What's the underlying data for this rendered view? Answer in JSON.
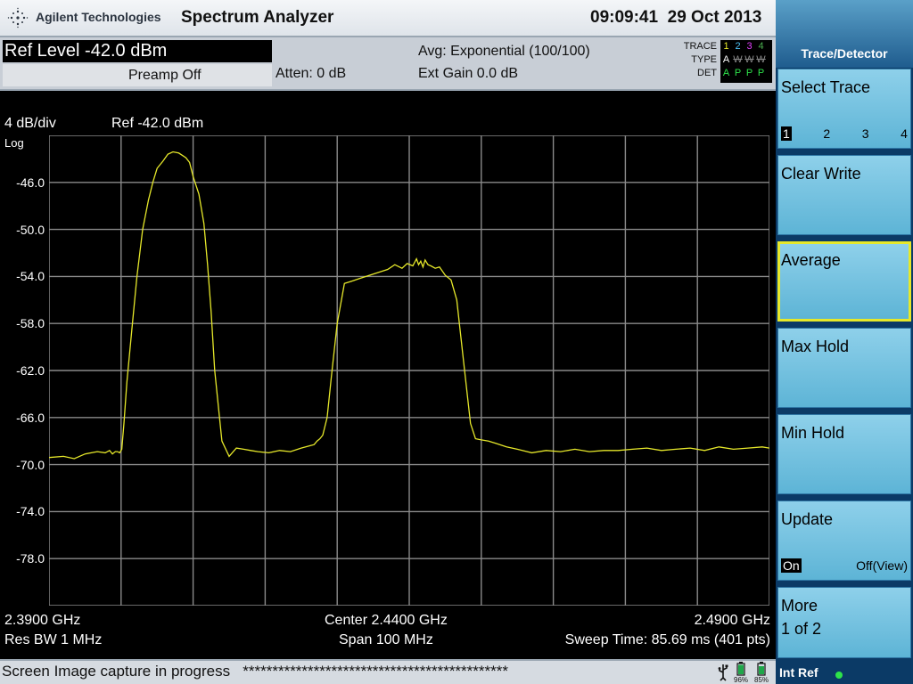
{
  "header": {
    "brand": "Agilent Technologies",
    "app_title": "Spectrum Analyzer",
    "time": "09:09:41",
    "date": "29 Oct 2013"
  },
  "settings": {
    "ref_level": "Ref Level -42.0 dBm",
    "preamp": "Preamp Off",
    "atten": "Atten: 0 dB",
    "avg": "Avg: Exponential (100/100)",
    "ext_gain": "Ext Gain 0.0 dB",
    "trace_labels": {
      "trace": "TRACE",
      "type": "TYPE",
      "det": "DET"
    },
    "trace_numbers": [
      "1",
      "2",
      "3",
      "4"
    ],
    "trace_types": [
      "A",
      "W",
      "W",
      "W"
    ],
    "trace_dets": [
      "A",
      "P",
      "P",
      "P"
    ],
    "trace_colors": [
      "#e6e82a",
      "#4fc3f7",
      "#e040fb",
      "#4caf50"
    ]
  },
  "graph": {
    "scale": "4 dB/div",
    "ref": "Ref -42.0 dBm",
    "log_label": "Log",
    "start_freq": "2.3900 GHz",
    "center_freq": "Center 2.4400 GHz",
    "stop_freq": "2.4900 GHz",
    "res_bw": "Res BW 1 MHz",
    "span": "Span 100 MHz",
    "sweep": "Sweep Time: 85.69 ms (401 pts)",
    "trace_color": "#e6e82a"
  },
  "chart_data": {
    "type": "line",
    "xlabel": "",
    "ylabel": "",
    "xlim": [
      2.39,
      2.49
    ],
    "ylim": [
      -82,
      -42
    ],
    "y_ticks": [
      -46.0,
      -50.0,
      -54.0,
      -58.0,
      -62.0,
      -66.0,
      -70.0,
      -74.0,
      -78.0
    ],
    "y_tick_labels": [
      "-46.0",
      "-50.0",
      "-54.0",
      "-58.0",
      "-62.0",
      "-66.0",
      "-70.0",
      "-74.0",
      "-78.0"
    ],
    "grid": true,
    "series": [
      {
        "x": [
          2.39,
          2.392,
          2.3935,
          2.395,
          2.3967,
          2.3978,
          2.3984,
          2.3988,
          2.3992,
          2.3995,
          2.3998,
          2.4001,
          2.4004,
          2.4008,
          2.4015,
          2.4022,
          2.403,
          2.4038,
          2.4044,
          2.405,
          2.4058,
          2.4065,
          2.4072,
          2.408,
          2.4085,
          2.409,
          2.4095,
          2.41,
          2.4108,
          2.4115,
          2.412,
          2.4125,
          2.413,
          2.414,
          2.415,
          2.416,
          2.417,
          2.418,
          2.419,
          2.4205,
          2.422,
          2.4235,
          2.425,
          2.4262,
          2.4268,
          2.4272,
          2.4276,
          2.428,
          2.4286,
          2.4292,
          2.43,
          2.431,
          2.432,
          2.433,
          2.434,
          2.435,
          2.436,
          2.437,
          2.438,
          2.439,
          2.4397,
          2.4405,
          2.441,
          2.4413,
          2.4416,
          2.4419,
          2.4422,
          2.4426,
          2.443,
          2.4436,
          2.4442,
          2.445,
          2.4458,
          2.4466,
          2.4475,
          2.4485,
          2.4492,
          2.45,
          2.451,
          2.452,
          2.4535,
          2.455,
          2.457,
          2.459,
          2.461,
          2.463,
          2.465,
          2.467,
          2.469,
          2.471,
          2.473,
          2.475,
          2.477,
          2.479,
          2.481,
          2.483,
          2.485,
          2.487,
          2.489,
          2.49
        ],
        "y": [
          -69.4,
          -69.3,
          -69.5,
          -69.1,
          -68.9,
          -69.0,
          -68.8,
          -69.1,
          -68.9,
          -68.9,
          -69.0,
          -68.7,
          -66.5,
          -63.0,
          -58.5,
          -54.0,
          -50.0,
          -47.5,
          -46.0,
          -44.8,
          -44.2,
          -43.6,
          -43.4,
          -43.5,
          -43.7,
          -43.9,
          -44.3,
          -45.5,
          -47.0,
          -49.5,
          -53.0,
          -57.0,
          -62.0,
          -68.0,
          -69.3,
          -68.6,
          -68.7,
          -68.8,
          -68.9,
          -69.0,
          -68.8,
          -68.9,
          -68.6,
          -68.4,
          -68.3,
          -68.0,
          -67.8,
          -67.5,
          -66.0,
          -62.5,
          -58.0,
          -54.6,
          -54.4,
          -54.2,
          -54.0,
          -53.8,
          -53.6,
          -53.4,
          -53.0,
          -53.3,
          -52.9,
          -53.1,
          -52.5,
          -53.0,
          -52.7,
          -53.2,
          -52.6,
          -53.0,
          -53.1,
          -53.3,
          -53.2,
          -53.9,
          -54.3,
          -56.0,
          -61.0,
          -66.5,
          -67.8,
          -67.9,
          -68.0,
          -68.2,
          -68.5,
          -68.7,
          -69.0,
          -68.8,
          -68.9,
          -68.7,
          -68.9,
          -68.8,
          -68.8,
          -68.7,
          -68.6,
          -68.8,
          -68.7,
          -68.6,
          -68.8,
          -68.5,
          -68.7,
          -68.6,
          -68.5,
          -68.6
        ]
      }
    ]
  },
  "status": {
    "message": "Screen Image capture in progress",
    "progress_text": "*********************************************",
    "battery_1": "96%",
    "battery_2": "85%"
  },
  "softkeys": {
    "title": "Trace/Detector",
    "select_trace": {
      "label": "Select Trace",
      "options": [
        "1",
        "2",
        "3",
        "4"
      ],
      "selected_index": 0
    },
    "clear_write": "Clear Write",
    "average": "Average",
    "max_hold": "Max Hold",
    "min_hold": "Min Hold",
    "update": {
      "label": "Update",
      "on": "On",
      "off": "Off(View)"
    },
    "more": {
      "label": "More",
      "sub": "1 of 2"
    },
    "int_ref": "Int Ref"
  }
}
